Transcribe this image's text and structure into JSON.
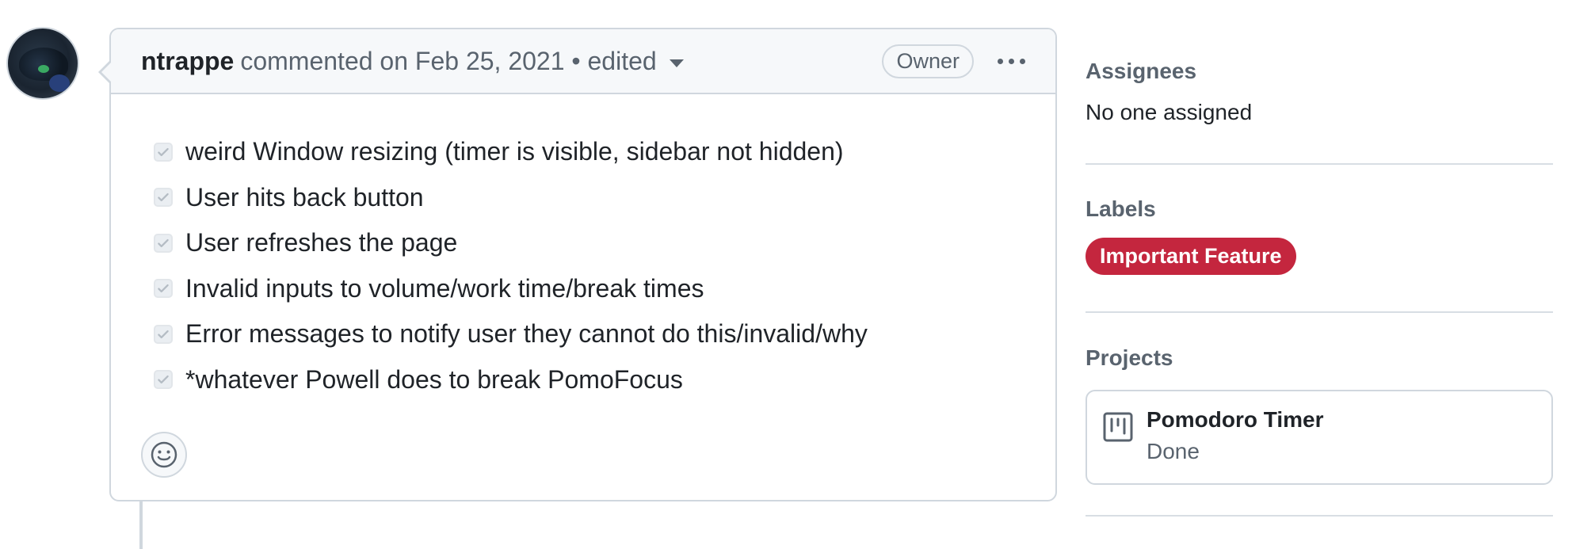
{
  "comment": {
    "author": "ntrappe",
    "meta": "commented on Feb 25, 2021 • edited",
    "badge": "Owner",
    "tasks": [
      "weird Window resizing (timer is visible, sidebar not hidden)",
      "User hits back button",
      "User refreshes the page",
      "Invalid inputs to volume/work time/break times",
      "Error messages to notify user they cannot do this/invalid/why",
      "*whatever Powell does to break PomoFocus"
    ]
  },
  "sidebar": {
    "assignees": {
      "heading": "Assignees",
      "value": "No one assigned"
    },
    "labels": {
      "heading": "Labels",
      "items": [
        {
          "name": "Important Feature",
          "color": "#c4263e"
        }
      ]
    },
    "projects": {
      "heading": "Projects",
      "items": [
        {
          "name": "Pomodoro Timer",
          "status": "Done"
        }
      ]
    }
  },
  "icons": [
    "avatar",
    "chevron-down-icon",
    "kebab-icon",
    "checkbox-checked-icon",
    "smiley-icon",
    "project-board-icon"
  ]
}
